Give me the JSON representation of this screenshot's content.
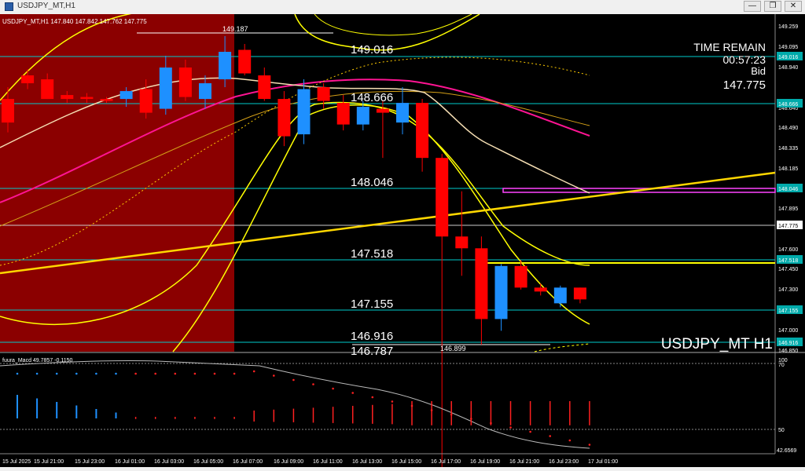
{
  "window": {
    "title": "USDJPY_MT,H1",
    "minimize": "—",
    "restore": "❐",
    "close": "✕",
    "icon": "chart-window-icon"
  },
  "chart_header": "USDJPY_MT,H1  147.840 147.842 147.762 147.775",
  "symbol_watermark": "USDJPY_MT H1",
  "info_box": {
    "line1": "TIME REMAIN",
    "line2": "00:57:23",
    "line3": "Bid",
    "line4": "147.775"
  },
  "price_scale": [
    "149.259",
    "149.095",
    "148.940",
    "148.640",
    "148.490",
    "148.335",
    "148.185",
    "148.035",
    "147.895",
    "147.600",
    "147.450",
    "147.300",
    "147.000",
    "146.850"
  ],
  "price_tags": {
    "level_149016": "149.016",
    "level_148666": "148.666",
    "level_148046": "148.046",
    "level_147775": "147.775",
    "level_147518": "147.518",
    "level_147155": "147.155",
    "level_146916": "146.916"
  },
  "level_labels": {
    "l149187": "149.187",
    "l149016": "149.016",
    "l148666": "148.666",
    "l148046": "148.046",
    "l147518": "147.518",
    "l147155": "147.155",
    "l146916": "146.916",
    "l146787": "146.787",
    "l146899": "146.899"
  },
  "indicator": {
    "label": "fuura_Macd 49.7857 -0.1150",
    "scale": [
      "100",
      "70",
      "50",
      "42.6569"
    ]
  },
  "time_axis": [
    "15 Jul 2025",
    "15 Jul 21:00",
    "15 Jul 23:00",
    "16 Jul 01:00",
    "16 Jul 03:00",
    "16 Jul 05:00",
    "16 Jul 07:00",
    "16 Jul 09:00",
    "16 Jul 11:00",
    "16 Jul 13:00",
    "16 Jul 15:00",
    "16 Jul 17:00",
    "16 Jul 19:00",
    "16 Jul 21:00",
    "16 Jul 23:00",
    "17 Jul 01:00"
  ],
  "colors": {
    "bull_candle": "#1e90ff",
    "bear_candle": "#ff0000",
    "level_line": "#00cccc",
    "trend_line": "#ffd700",
    "shade": "#8b0000",
    "fast_ma": "#ff1493",
    "bands": "#ffff00",
    "tag_bg": "#00aaaa"
  },
  "candles": [
    {
      "o": 148.8,
      "h": 148.86,
      "l": 148.63,
      "c": 148.68
    },
    {
      "o": 148.92,
      "h": 148.95,
      "l": 148.85,
      "c": 148.88
    },
    {
      "o": 148.9,
      "h": 148.93,
      "l": 148.8,
      "c": 148.8
    },
    {
      "o": 148.82,
      "h": 148.84,
      "l": 148.78,
      "c": 148.8
    },
    {
      "o": 148.81,
      "h": 148.83,
      "l": 148.78,
      "c": 148.8
    },
    {
      "o": 148.8,
      "h": 148.81,
      "l": 148.78,
      "c": 148.79
    },
    {
      "o": 148.8,
      "h": 148.86,
      "l": 148.76,
      "c": 148.84
    },
    {
      "o": 148.85,
      "h": 148.9,
      "l": 148.7,
      "c": 148.73
    },
    {
      "o": 148.75,
      "h": 149.02,
      "l": 148.72,
      "c": 148.96
    },
    {
      "o": 148.96,
      "h": 149.0,
      "l": 148.79,
      "c": 148.81
    },
    {
      "o": 148.8,
      "h": 148.92,
      "l": 148.75,
      "c": 148.88
    },
    {
      "o": 148.9,
      "h": 149.12,
      "l": 148.86,
      "c": 149.04
    },
    {
      "o": 149.05,
      "h": 149.08,
      "l": 148.92,
      "c": 148.93
    },
    {
      "o": 148.92,
      "h": 148.96,
      "l": 148.79,
      "c": 148.8
    },
    {
      "o": 148.8,
      "h": 148.84,
      "l": 148.56,
      "c": 148.61
    },
    {
      "o": 148.62,
      "h": 148.9,
      "l": 148.57,
      "c": 148.85
    },
    {
      "o": 148.86,
      "h": 148.88,
      "l": 148.75,
      "c": 148.79
    },
    {
      "o": 148.78,
      "h": 148.82,
      "l": 148.64,
      "c": 148.67
    },
    {
      "o": 148.67,
      "h": 148.79,
      "l": 148.64,
      "c": 148.76
    },
    {
      "o": 148.75,
      "h": 148.79,
      "l": 148.5,
      "c": 148.73
    },
    {
      "o": 148.68,
      "h": 148.86,
      "l": 148.62,
      "c": 148.78
    },
    {
      "o": 148.78,
      "h": 148.8,
      "l": 148.43,
      "c": 148.5
    },
    {
      "o": 148.5,
      "h": 148.52,
      "l": 146.9,
      "c": 148.1
    },
    {
      "o": 148.1,
      "h": 148.33,
      "l": 147.9,
      "c": 148.04
    },
    {
      "o": 148.04,
      "h": 148.1,
      "l": 147.55,
      "c": 147.68
    },
    {
      "o": 147.68,
      "h": 147.96,
      "l": 147.62,
      "c": 147.95
    },
    {
      "o": 147.95,
      "h": 147.98,
      "l": 147.83,
      "c": 147.84
    },
    {
      "o": 147.84,
      "h": 147.86,
      "l": 147.8,
      "c": 147.82
    },
    {
      "o": 147.76,
      "h": 147.85,
      "l": 147.74,
      "c": 147.84
    },
    {
      "o": 147.84,
      "h": 147.84,
      "l": 147.76,
      "c": 147.78
    }
  ]
}
